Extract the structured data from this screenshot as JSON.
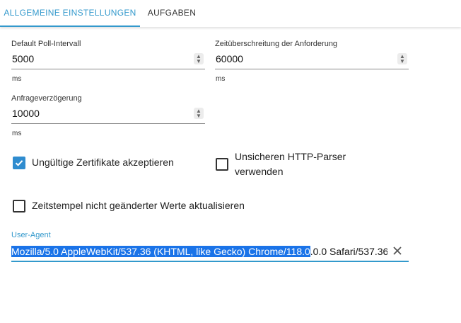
{
  "tabs": [
    {
      "label": "ALLGEMEINE EINSTELLUNGEN",
      "active": true
    },
    {
      "label": "AUFGABEN",
      "active": false
    }
  ],
  "fields": {
    "poll_interval": {
      "label": "Default Poll-Intervall",
      "value": "5000",
      "unit": "ms"
    },
    "request_timeout": {
      "label": "Zeitüberschreitung der Anforderung",
      "value": "60000",
      "unit": "ms"
    },
    "request_delay": {
      "label": "Anfrageverzögerung",
      "value": "10000",
      "unit": "ms"
    }
  },
  "checkboxes": {
    "accept_invalid_certs": {
      "label": "Ungültige Zertifikate akzeptieren",
      "checked": true
    },
    "insecure_http_parser": {
      "label": "Unsicheren HTTP-Parser verwenden",
      "checked": false
    },
    "update_unchanged_timestamps": {
      "label": "Zeitstempel nicht geänderter Werte aktualisieren",
      "checked": false
    }
  },
  "user_agent": {
    "label": "User-Agent",
    "value_selected": "Mozilla/5.0 AppleWebKit/537.36 (KHTML, like Gecko) Chrome/118.0",
    "value_rest": ".0.0 Safari/537.36"
  },
  "colors": {
    "accent": "#3399cc",
    "checkbox": "#2f8ccf",
    "selection": "#1a73e8"
  },
  "icons": {
    "stepper": "up-down-arrows-icon",
    "clear": "close-icon",
    "check": "checkmark-icon"
  }
}
